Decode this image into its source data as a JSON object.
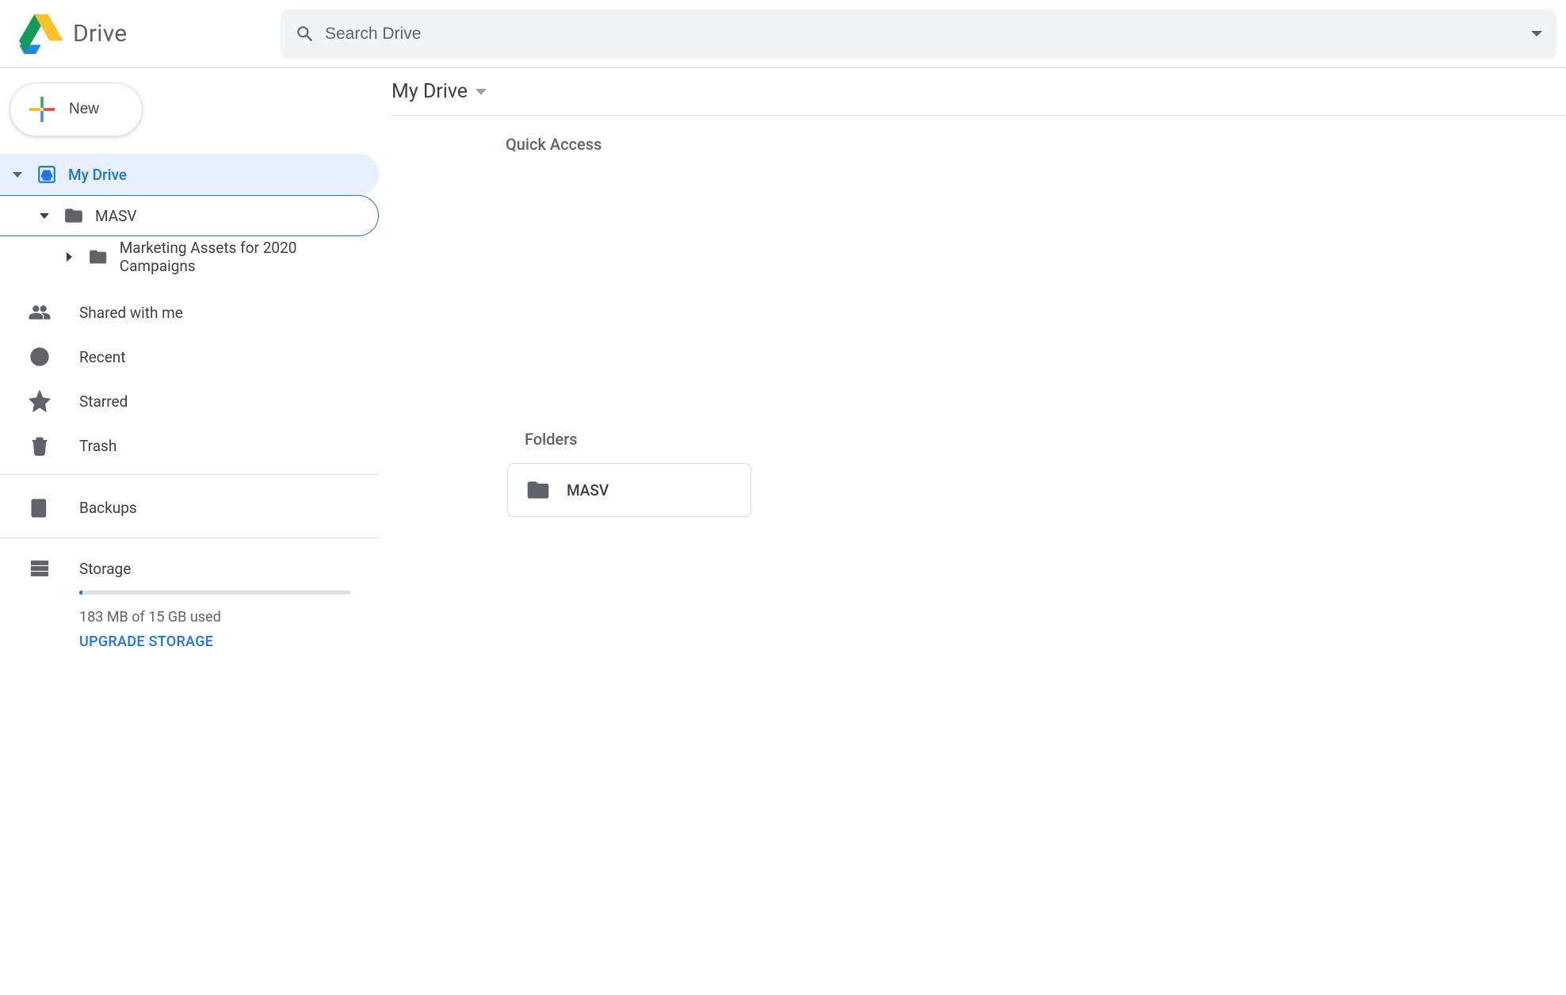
{
  "app": {
    "title": "Drive"
  },
  "search": {
    "placeholder": "Search Drive"
  },
  "new_button": {
    "label": "New"
  },
  "tree": {
    "my_drive": "My Drive",
    "masv": "MASV",
    "sub1": "Marketing Assets for 2020 Campaigns"
  },
  "nav": {
    "shared": "Shared with me",
    "recent": "Recent",
    "starred": "Starred",
    "trash": "Trash",
    "backups": "Backups"
  },
  "storage": {
    "title": "Storage",
    "used_text": "183 MB of 15 GB used",
    "upgrade": "UPGRADE STORAGE"
  },
  "main": {
    "crumb": "My Drive",
    "quick_access": "Quick Access",
    "folders_label": "Folders",
    "folders": [
      {
        "name": "MASV"
      }
    ]
  }
}
